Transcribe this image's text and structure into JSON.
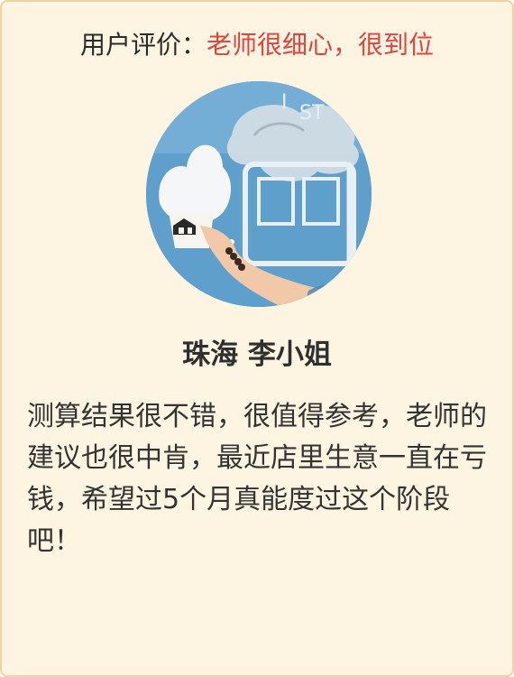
{
  "review": {
    "label": "用户评价：",
    "headline": "老师很细心，很到位",
    "avatar_icon": "reviewer-photo",
    "reviewer_name": "珠海 李小姐",
    "text": "测算结果很不错，很值得参考，老师的建议也很中肯，最近店里生意一直在亏钱，希望过5个月真能度过这个阶段吧！"
  },
  "colors": {
    "card_background": "#fdf5e2",
    "card_border": "#f1d3a0",
    "headline": "#e4433c",
    "body_text": "#333333"
  }
}
